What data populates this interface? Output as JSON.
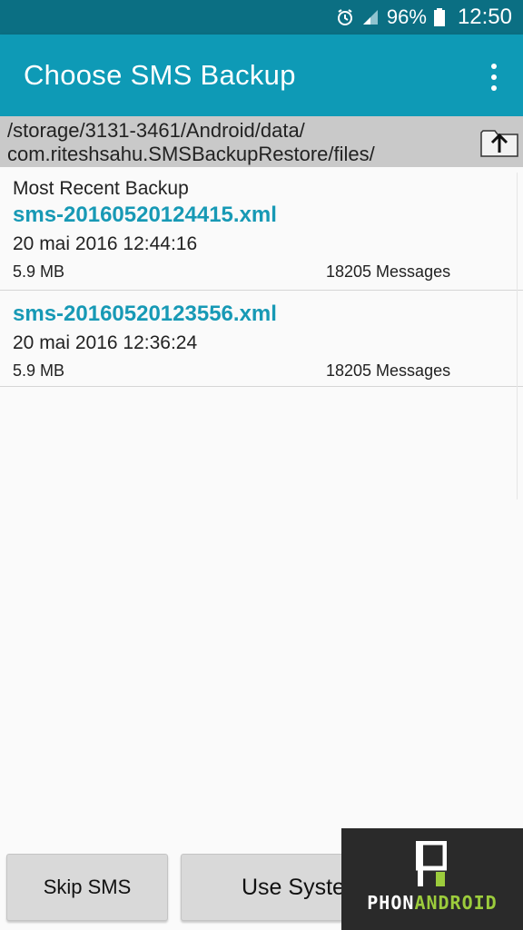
{
  "status_bar": {
    "battery": "96%",
    "time": "12:50",
    "icons": [
      "alarm-icon",
      "signal-icon",
      "battery-icon"
    ]
  },
  "app_bar": {
    "title": "Choose SMS Backup",
    "menu_icon": "overflow-menu-icon"
  },
  "path": {
    "line1": "/storage/3131-3461/Android/data/",
    "line2": "com.riteshsahu.SMSBackupRestore/files/",
    "up_icon": "folder-up-icon"
  },
  "backups": [
    {
      "section": "Most Recent Backup",
      "filename": "sms-20160520124415.xml",
      "date": "20 mai 2016 12:44:16",
      "size": "5.9 MB",
      "count": "18205 Messages"
    },
    {
      "filename": "sms-20160520123556.xml",
      "date": "20 mai 2016 12:36:24",
      "size": "5.9 MB",
      "count": "18205 Messages"
    }
  ],
  "buttons": {
    "skip": "Skip SMS",
    "use": "Use Syste"
  },
  "watermark": {
    "prefix": "PHON",
    "suffix": "ANDROID"
  },
  "colors": {
    "status_bar": "#0b6f83",
    "app_bar": "#0e9ab6",
    "filename": "#1799b5"
  }
}
